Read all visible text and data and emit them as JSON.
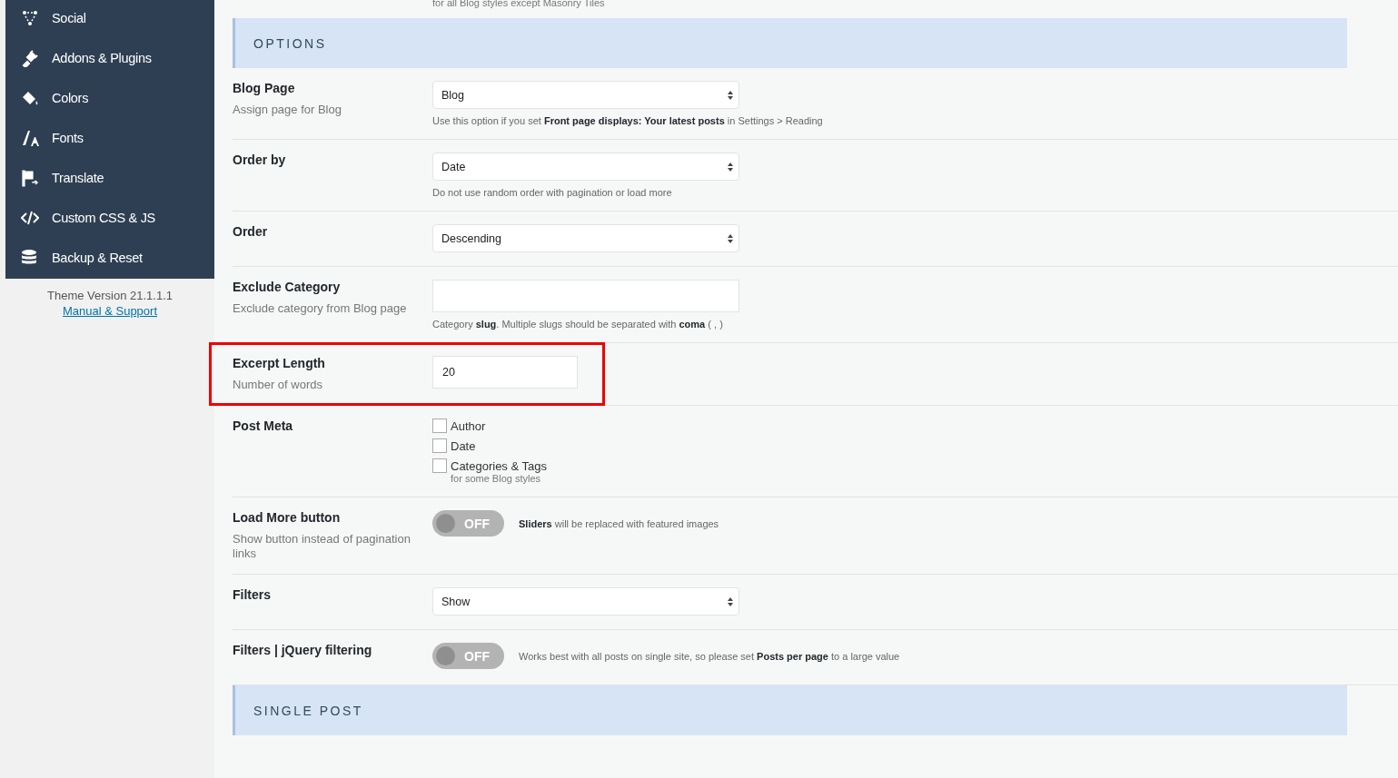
{
  "sidebar": {
    "items": [
      {
        "label": "Social",
        "kind": "social"
      },
      {
        "label": "Addons & Plugins",
        "kind": "plugin"
      },
      {
        "label": "Colors",
        "kind": "colors"
      },
      {
        "label": "Fonts",
        "kind": "fonts"
      },
      {
        "label": "Translate",
        "kind": "translate"
      },
      {
        "label": "Custom CSS & JS",
        "kind": "code"
      },
      {
        "label": "Backup & Reset",
        "kind": "backup"
      }
    ],
    "theme_version": "Theme Version 21.1.1.1",
    "support_link": "Manual & Support"
  },
  "top_note": "for all Blog styles except Masonry Tiles",
  "sections": [
    {
      "title": "OPTIONS",
      "rows": [
        {
          "label": "Blog Page",
          "description": "Assign page for Blog",
          "kind": "select",
          "value": "Blog",
          "hint": "Use this option if you set **Front page displays: Your latest posts** in Settings > Reading",
          "highlighted": false
        },
        {
          "label": "Order by",
          "kind": "select",
          "value": "Date",
          "hint": "Do not use random order with pagination or load more",
          "highlighted": false
        },
        {
          "label": "Order",
          "kind": "select",
          "value": "Descending",
          "highlighted": false
        },
        {
          "label": "Exclude Category",
          "description": "Exclude category from Blog page",
          "kind": "text",
          "hint": "Category **slug**. Multiple slugs should be separated with **coma** ( , )",
          "highlighted": false
        },
        {
          "label": "Excerpt Length",
          "description": "Number of words",
          "kind": "number",
          "value": "20",
          "highlighted": true
        },
        {
          "label": "Post Meta",
          "kind": "checkboxes",
          "highlighted": false,
          "options": [
            {
              "label": "Author",
              "checked": false
            },
            {
              "label": "Date",
              "checked": false
            },
            {
              "label": "Categories & Tags",
              "checked": false,
              "note": "for some Blog styles"
            }
          ]
        },
        {
          "label": "Load More button",
          "description": "Show button instead of pagination links",
          "kind": "toggle",
          "on": false,
          "toggle_label": "OFF",
          "hint": "**Sliders** will be replaced with featured images",
          "highlighted": false
        },
        {
          "label": "Filters",
          "kind": "select",
          "value": "Show",
          "highlighted": false
        },
        {
          "label": "Filters | jQuery filtering",
          "kind": "toggle",
          "on": false,
          "toggle_label": "OFF",
          "hint": "Works best with all posts on single site, so please set **Posts per page** to a large value",
          "highlighted": false
        }
      ]
    },
    {
      "title": "SINGLE POST"
    }
  ]
}
